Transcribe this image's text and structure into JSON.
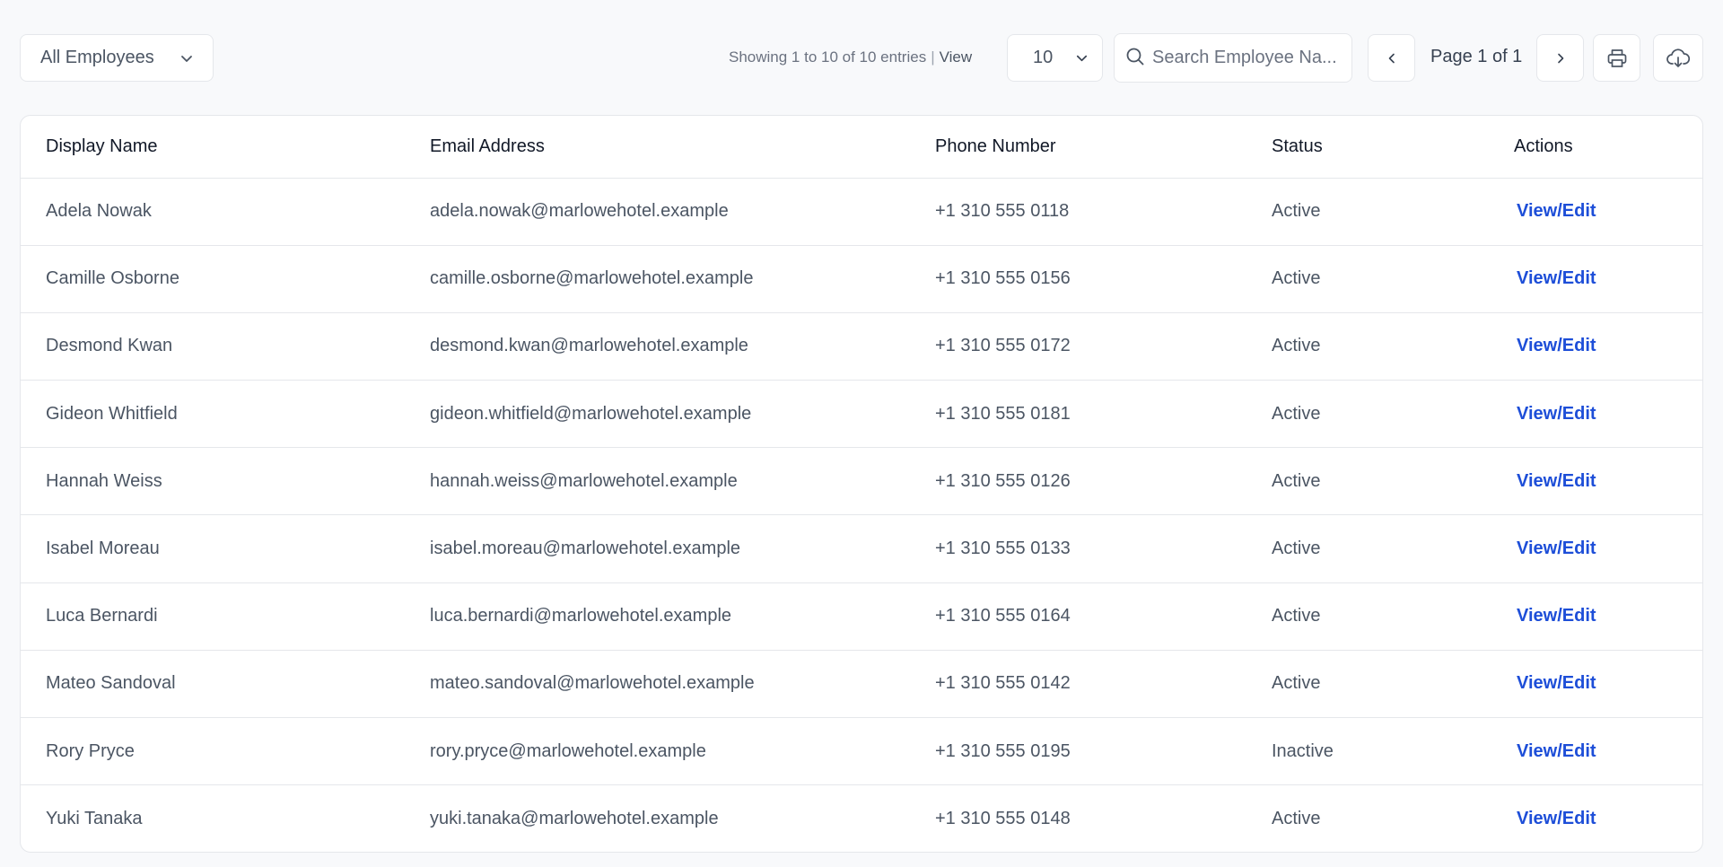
{
  "toolbar": {
    "filter_value": "All Employees",
    "entries_text": "Showing 1 to 10 of 10 entries",
    "entries_separator": "|",
    "view_label": "View",
    "page_size_value": "10",
    "search_placeholder": "Search Employee Na...",
    "page_label": "Page 1 of 1",
    "icons": {
      "filter_chevron": "chevron-down-icon",
      "page_size_chevron": "chevron-down-icon",
      "search": "search-icon",
      "prev": "chevron-left-icon",
      "next": "chevron-right-icon",
      "print": "printer-icon",
      "download": "cloud-download-icon"
    }
  },
  "table": {
    "columns": [
      "Display Name",
      "Email Address",
      "Phone Number",
      "Status",
      "Actions"
    ],
    "rows": [
      {
        "name": "Adela Nowak",
        "email": "adela.nowak@marlowehotel.example",
        "phone": "+1 310 555 0118",
        "status": "Active",
        "action": "View/Edit"
      },
      {
        "name": "Camille Osborne",
        "email": "camille.osborne@marlowehotel.example",
        "phone": "+1 310 555 0156",
        "status": "Active",
        "action": "View/Edit"
      },
      {
        "name": "Desmond Kwan",
        "email": "desmond.kwan@marlowehotel.example",
        "phone": "+1 310 555 0172",
        "status": "Active",
        "action": "View/Edit"
      },
      {
        "name": "Gideon Whitfield",
        "email": "gideon.whitfield@marlowehotel.example",
        "phone": "+1 310 555 0181",
        "status": "Active",
        "action": "View/Edit"
      },
      {
        "name": "Hannah Weiss",
        "email": "hannah.weiss@marlowehotel.example",
        "phone": "+1 310 555 0126",
        "status": "Active",
        "action": "View/Edit"
      },
      {
        "name": "Isabel Moreau",
        "email": "isabel.moreau@marlowehotel.example",
        "phone": "+1 310 555 0133",
        "status": "Active",
        "action": "View/Edit"
      },
      {
        "name": "Luca Bernardi",
        "email": "luca.bernardi@marlowehotel.example",
        "phone": "+1 310 555 0164",
        "status": "Active",
        "action": "View/Edit"
      },
      {
        "name": "Mateo Sandoval",
        "email": "mateo.sandoval@marlowehotel.example",
        "phone": "+1 310 555 0142",
        "status": "Active",
        "action": "View/Edit"
      },
      {
        "name": "Rory Pryce",
        "email": "rory.pryce@marlowehotel.example",
        "phone": "+1 310 555 0195",
        "status": "Inactive",
        "action": "View/Edit"
      },
      {
        "name": "Yuki Tanaka",
        "email": "yuki.tanaka@marlowehotel.example",
        "phone": "+1 310 555 0148",
        "status": "Active",
        "action": "View/Edit"
      }
    ]
  },
  "colors": {
    "background": "#f8f9fb",
    "link": "#1d4ed8",
    "border": "#e5e7eb",
    "text": "#4b5563",
    "heading": "#111827"
  }
}
